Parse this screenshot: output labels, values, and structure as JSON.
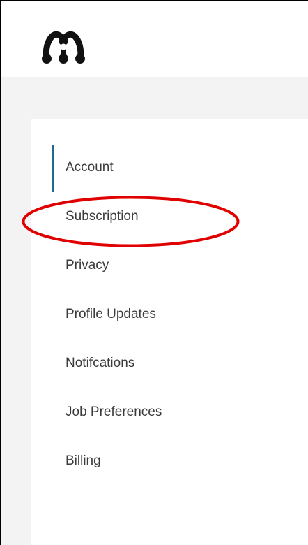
{
  "brand": {
    "logo_icon": "mendeley-logo-icon",
    "logo_color": "#111111"
  },
  "nav": {
    "active_color": "#1f6a8e",
    "items": [
      {
        "label": "Account",
        "active": true
      },
      {
        "label": "Subscription",
        "active": false
      },
      {
        "label": "Privacy",
        "active": false
      },
      {
        "label": "Profile Updates",
        "active": false
      },
      {
        "label": "Notifcations",
        "active": false
      },
      {
        "label": "Job Preferences",
        "active": false
      },
      {
        "label": "Billing",
        "active": false
      }
    ]
  },
  "annotation": {
    "shape": "ellipse",
    "color": "#e00000",
    "target": "Subscription"
  }
}
